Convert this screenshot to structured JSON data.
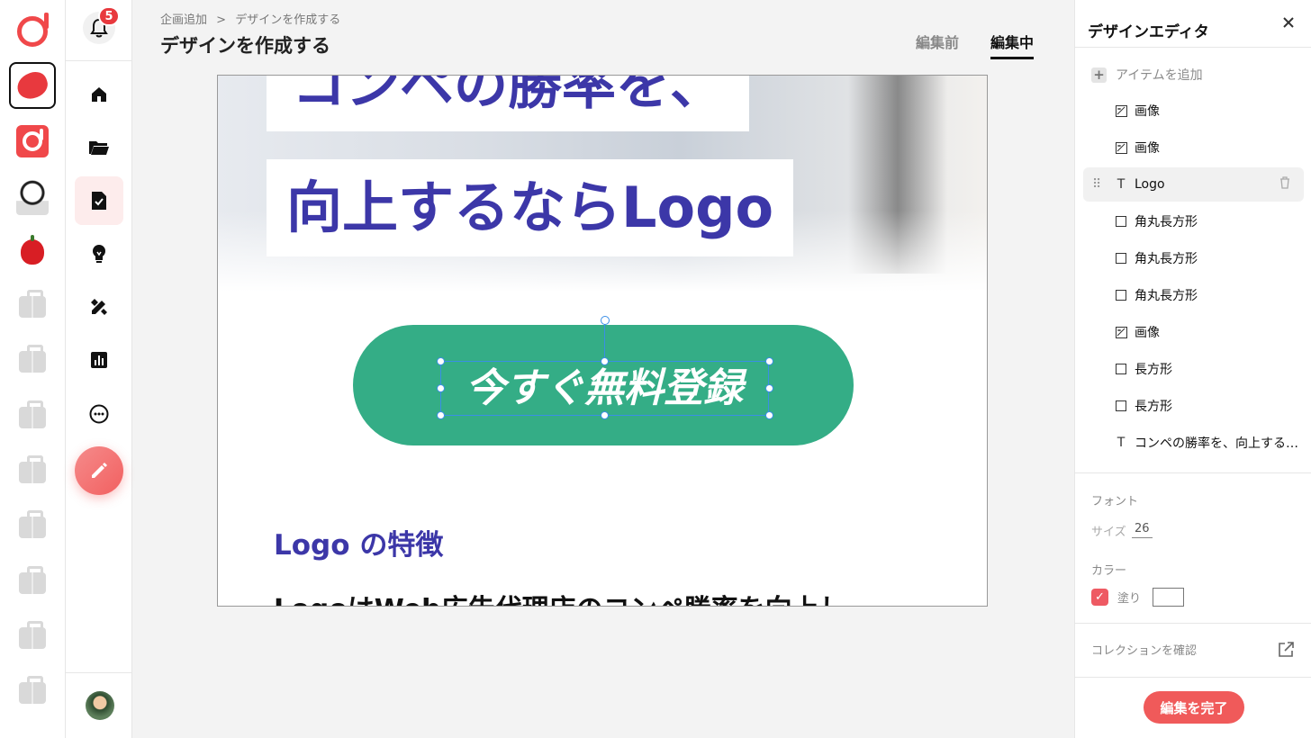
{
  "notifications": {
    "count": "5"
  },
  "header": {
    "breadcrumb": [
      "企画追加",
      ">",
      "デザインを作成する"
    ],
    "title": "デザインを作成する",
    "tabs": [
      {
        "label": "編集前",
        "active": false
      },
      {
        "label": "編集中",
        "active": true
      }
    ]
  },
  "rail": {
    "apps": [
      "brand-logo",
      "brand-red-blob",
      "brand-logo-square",
      "illustration-avatar",
      "apple-app",
      "bag",
      "bag",
      "bag",
      "bag",
      "bag",
      "bag",
      "bag"
    ],
    "active_index": 1
  },
  "nav": {
    "items": [
      "home-icon",
      "folder-icon",
      "document-check-icon",
      "lightbulb-icon",
      "pencil-design-icon",
      "chart-icon",
      "more-icon"
    ],
    "active_index": 2
  },
  "canvas": {
    "hero_line1": "コンペの勝率を、",
    "hero_line2": "向上するならLogo",
    "cta_text": "今すぐ無料登録",
    "feature_title": "Logo の特徴",
    "feature_body": "LogoはWeb広告代理店のコンペ勝率を向上し"
  },
  "panel": {
    "title": "デザインエディタ",
    "add_item": "アイテムを追加",
    "layers": [
      {
        "icon": "image-icon",
        "label": "画像"
      },
      {
        "icon": "image-icon",
        "label": "画像"
      },
      {
        "icon": "text-icon",
        "label": "Logo",
        "selected": true
      },
      {
        "icon": "rectangle-icon",
        "label": "角丸長方形"
      },
      {
        "icon": "rectangle-icon",
        "label": "角丸長方形"
      },
      {
        "icon": "rectangle-icon",
        "label": "角丸長方形"
      },
      {
        "icon": "image-icon",
        "label": "画像"
      },
      {
        "icon": "rectangle-icon",
        "label": "長方形"
      },
      {
        "icon": "rectangle-icon",
        "label": "長方形"
      },
      {
        "icon": "text-icon",
        "label": "コンペの勝率を、向上するならLogo"
      }
    ],
    "font_label": "フォント",
    "size_label": "サイズ",
    "size_value": "26",
    "color_label": "カラー",
    "fill_label": "塗り",
    "fill_checked": true,
    "fill_color": "#ffffff",
    "collection_label": "コレクションを確認",
    "done_label": "編集を完了"
  },
  "colors": {
    "accent": "#f05a5a",
    "brand_blue": "#3c37a8",
    "cta_green": "#34ad86",
    "selection": "#3a8ee6"
  }
}
